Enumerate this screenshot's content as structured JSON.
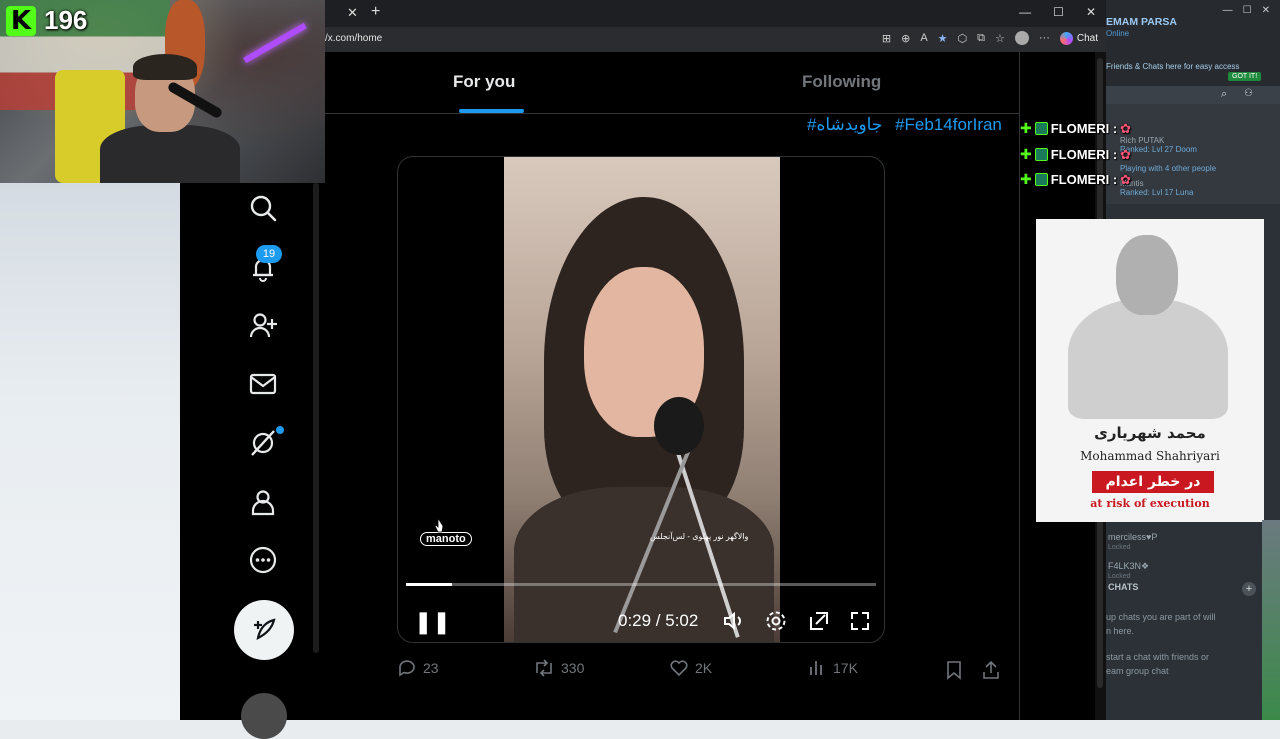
{
  "stream": {
    "kick_count": "196"
  },
  "browser": {
    "url": "/x.com/home",
    "chat_label": "Chat"
  },
  "timeline": {
    "tab_for_you": "For you",
    "tab_following": "Following",
    "hashtag_1": "#جاویدشاه",
    "hashtag_2": "#Feb14forIran"
  },
  "video": {
    "watermark": "manoto",
    "caption": "والاگهر نور پهلوی - لس‌آنجلس",
    "time": "0:29 / 5:02",
    "progress": 0.097
  },
  "actions": {
    "replies": "23",
    "reposts": "330",
    "likes": "2K",
    "views": "17K"
  },
  "sidebar": {
    "notifications_badge": "19"
  },
  "steam": {
    "name": "EMAM PARSA",
    "status": "Online",
    "tip": "Friends & Chats here for easy access",
    "got_it": "GOT IT!",
    "friend_1_name": "Rich PUTAK",
    "friend_1_status": "Ranked: Lvl 27 Doom",
    "friend_2_status": "Playing with 4 other people",
    "friend_3_name": "Mantis",
    "friend_3_status": "Ranked: Lvl 17 Luna",
    "friend_4_name": "merciless♥P",
    "friend_4_status": "Locked",
    "friend_5_name": "F4LK3N❖",
    "friend_5_status": "Locked",
    "chats_header": "CHATS",
    "chats_line_1": "up chats you are part of will",
    "chats_line_2": "n here.",
    "chats_line_3": "start a chat with friends or",
    "chats_line_4": "eam group chat"
  },
  "chat_overlay": {
    "user": "FLOMERI :"
  },
  "execution_card": {
    "name_fa": "محمد شهریاری",
    "name_en": "Mohammad Shahriyari",
    "label_fa": "در خطر اعدام",
    "label_en": "at risk of execution"
  }
}
